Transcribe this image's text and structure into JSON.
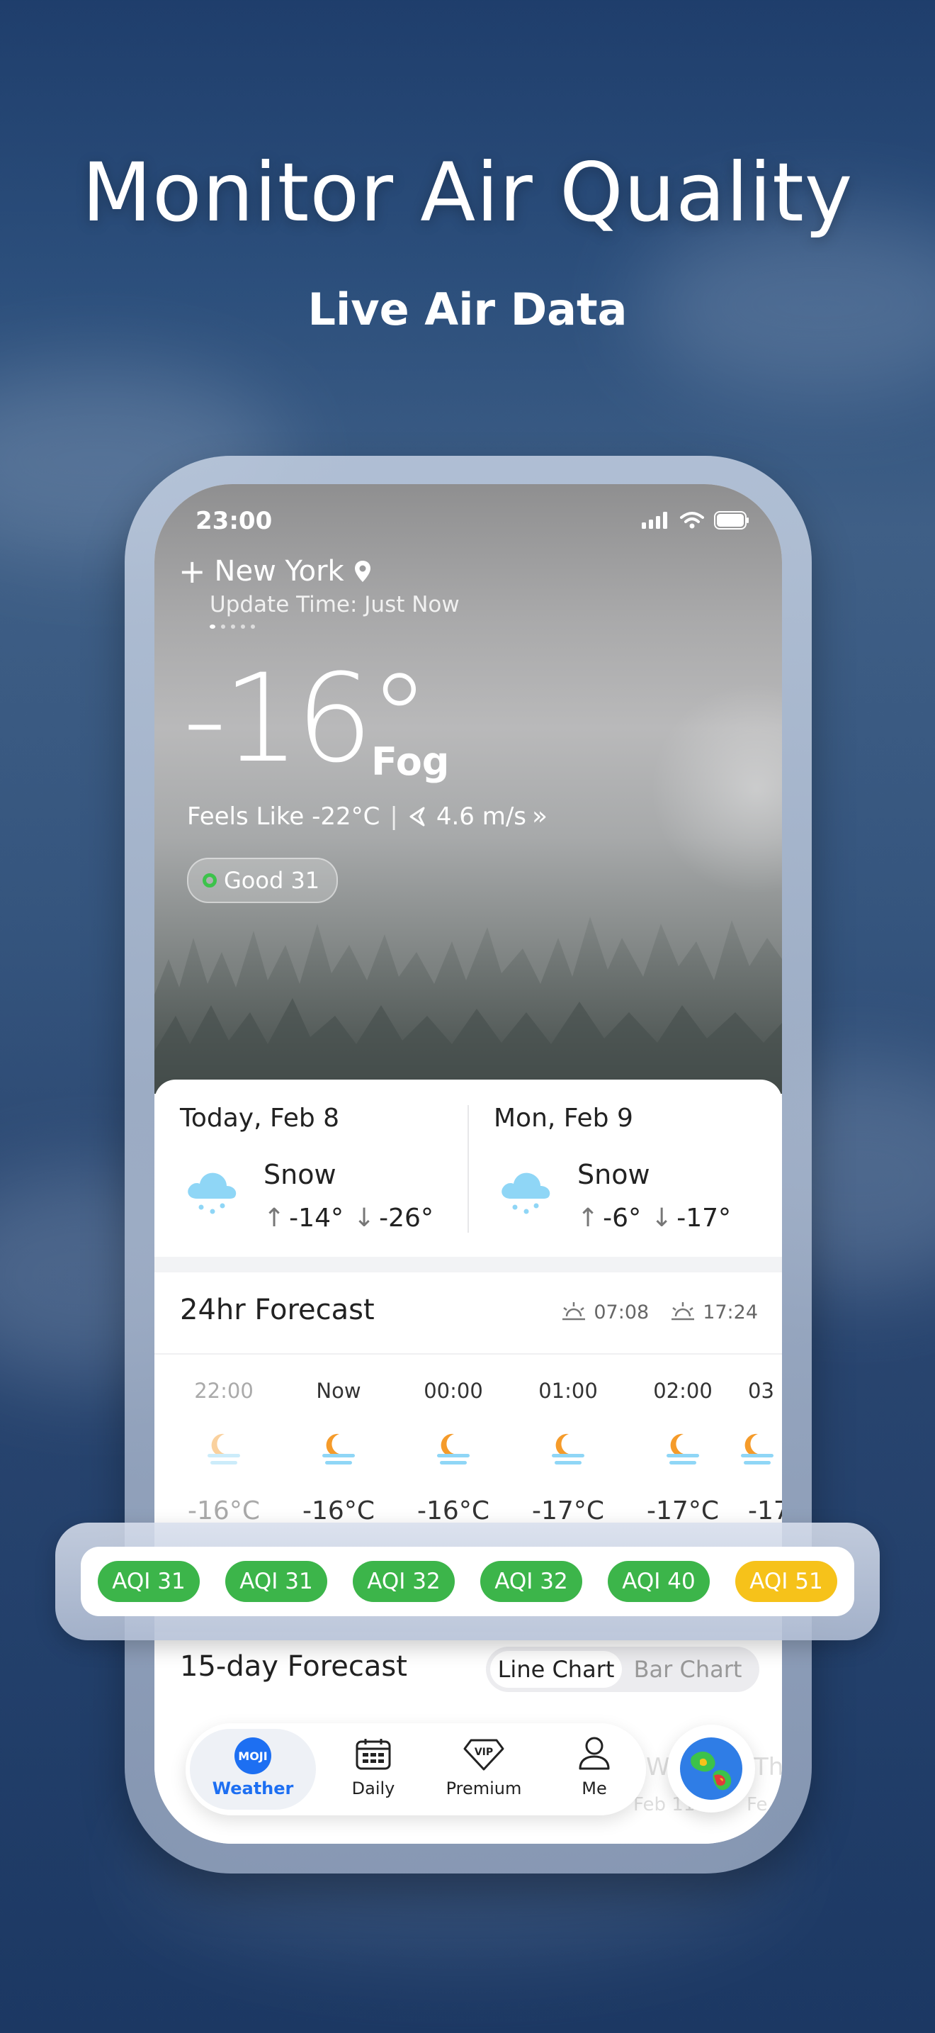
{
  "hero": {
    "title": "Monitor Air Quality",
    "subtitle": "Live Air Data"
  },
  "status_bar": {
    "time": "23:00"
  },
  "location": {
    "city": "New York",
    "update_time": "Update Time: Just Now"
  },
  "current": {
    "temperature": "-16°",
    "condition": "Fog",
    "feels_like": "Feels Like -22°C",
    "wind": "4.6 m/s",
    "aqi_badge": "Good 31"
  },
  "daily_summary": [
    {
      "title": "Today, Feb 8",
      "condition": "Snow",
      "high": "-14°",
      "low": "-26°"
    },
    {
      "title": "Mon, Feb 9",
      "condition": "Snow",
      "high": "-6°",
      "low": "-17°"
    }
  ],
  "forecast_24h": {
    "title": "24hr Forecast",
    "sunrise": "07:08",
    "sunset": "17:24",
    "hours": [
      {
        "time": "22:00",
        "temp": "-16°C"
      },
      {
        "time": "Now",
        "temp": "-16°C"
      },
      {
        "time": "00:00",
        "temp": "-16°C"
      },
      {
        "time": "01:00",
        "temp": "-17°C"
      },
      {
        "time": "02:00",
        "temp": "-17°C"
      },
      {
        "time": "03",
        "temp": "-17"
      }
    ],
    "aqi": [
      {
        "label": "AQI 31",
        "value": 31,
        "color": "#3cb54a"
      },
      {
        "label": "AQI 31",
        "value": 31,
        "color": "#3cb54a"
      },
      {
        "label": "AQI 32",
        "value": 32,
        "color": "#3cb54a"
      },
      {
        "label": "AQI 32",
        "value": 32,
        "color": "#3cb54a"
      },
      {
        "label": "AQI 40",
        "value": 40,
        "color": "#3cb54a"
      },
      {
        "label": "AQI 51",
        "value": 51,
        "color": "#f6c21a"
      }
    ]
  },
  "forecast_15d": {
    "title": "15-day Forecast",
    "view_options": [
      "Line Chart",
      "Bar Chart"
    ],
    "selected_view": "Line Chart",
    "peek_days": [
      "W",
      "Th"
    ],
    "peek_dates": [
      "Feb 11",
      "Fe"
    ]
  },
  "nav": {
    "items": [
      {
        "label": "Weather",
        "icon": "moji-logo-icon",
        "active": true,
        "logo_text": "MOJI"
      },
      {
        "label": "Daily",
        "icon": "calendar-icon",
        "active": false
      },
      {
        "label": "Premium",
        "icon": "vip-diamond-icon",
        "active": false,
        "icon_text": "VIP"
      },
      {
        "label": "Me",
        "icon": "person-icon",
        "active": false
      }
    ]
  },
  "colors": {
    "accent_blue": "#1d6ff2",
    "aqi_good": "#3cb54a",
    "aqi_moderate": "#f6c21a"
  }
}
